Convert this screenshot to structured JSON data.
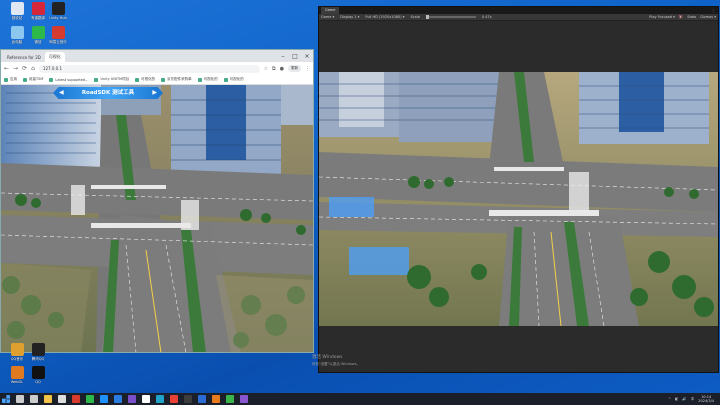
{
  "desktop": {
    "icons_top": [
      {
        "label": "回收站",
        "color": "#dfe8f2",
        "x": 6
      },
      {
        "label": "有道翻译",
        "color": "#d6263a",
        "x": 27
      },
      {
        "label": "Unity Hub",
        "color": "#222222",
        "x": 47
      }
    ],
    "icons_row2": [
      {
        "label": "此电脑",
        "color": "#8cc7f0",
        "x": 6
      },
      {
        "label": "微信",
        "color": "#2fb84a",
        "x": 27
      },
      {
        "label": "网易云音乐",
        "color": "#d63b2f",
        "x": 47
      }
    ],
    "icons_bottom": [
      {
        "label": "QQ音乐",
        "color": "#e0a030",
        "x": 6
      },
      {
        "label": "腾讯QQ",
        "color": "#222222",
        "x": 27
      }
    ],
    "icons_low": [
      {
        "label": "WebGL",
        "color": "#e07a20",
        "x": 6
      },
      {
        "label": "QQ",
        "color": "#111111",
        "x": 27
      }
    ]
  },
  "browser": {
    "tabs": [
      {
        "label": "Reference for 3D",
        "active": false
      },
      {
        "label": "可视化",
        "active": true
      }
    ],
    "nav": {
      "back": "←",
      "forward": "→",
      "reload": "⟳",
      "home": "⌂"
    },
    "url": "127.0.0.1",
    "pill": "更新",
    "bookmarks": [
      "应用",
      "用量TSM",
      "Latest supported...",
      "Unity UNITM项目",
      "可视化的",
      "京东配件采购单",
      "可视化的",
      "可视化的"
    ],
    "page": {
      "title": "RoadSDK 测试工具",
      "left_arrow": "◀",
      "right_arrow": "▶"
    }
  },
  "unity": {
    "tab_label": "Game",
    "tab_menu": "⋮",
    "toolbar": {
      "display_mode": "Game",
      "display": "Display 1",
      "resolution": "Full HD (1920x1080)",
      "scale_label": "Scale",
      "scale_value": "0.47x",
      "focus": "Play Focused",
      "stats": "Stats",
      "gizmos": "Gizmos"
    },
    "watermark_line1": "激活 Windows",
    "watermark_line2": "转到\"设置\"以激活 Windows。"
  },
  "taskbar": {
    "items": [
      {
        "name": "start-button",
        "color": "#4aa3ff"
      },
      {
        "name": "search-button",
        "color": "#cccccc"
      },
      {
        "name": "task-view",
        "color": "#cccccc"
      },
      {
        "name": "file-explorer",
        "color": "#f3c34a"
      },
      {
        "name": "unity-hub",
        "color": "#dddddd"
      },
      {
        "name": "netease-cloud",
        "color": "#d63b2f"
      },
      {
        "name": "wechat",
        "color": "#2fb84a"
      },
      {
        "name": "qq",
        "color": "#1e90ff"
      },
      {
        "name": "vs-code",
        "color": "#2a7de1"
      },
      {
        "name": "visual-studio",
        "color": "#7b4fc9"
      },
      {
        "name": "unity",
        "color": "#ffffff"
      },
      {
        "name": "edge",
        "color": "#1fa3c9"
      },
      {
        "name": "chrome",
        "color": "#e94235"
      },
      {
        "name": "terminal",
        "color": "#3c3c3c"
      },
      {
        "name": "app-blue",
        "color": "#2b6cd6"
      },
      {
        "name": "app-orange",
        "color": "#e57b1e"
      },
      {
        "name": "app-green",
        "color": "#3bb54a"
      },
      {
        "name": "app-purple",
        "color": "#8a56cf"
      }
    ],
    "tray": {
      "up": "^",
      "lang": "中",
      "time": "10:14",
      "date": "2024/3/4"
    }
  }
}
